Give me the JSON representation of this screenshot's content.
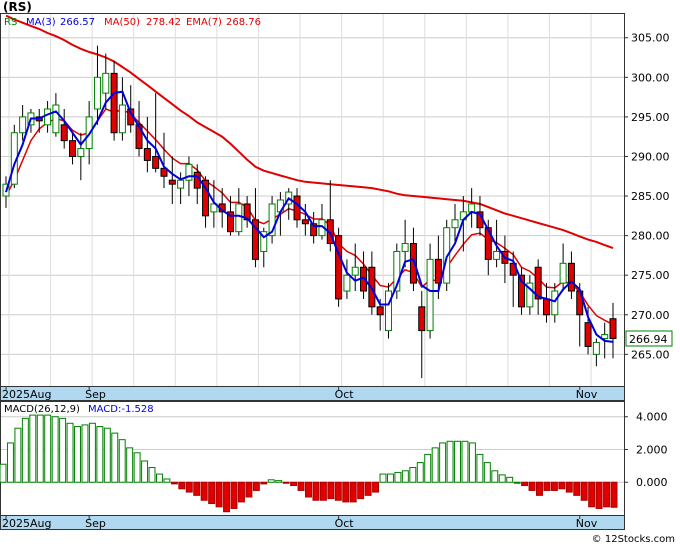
{
  "header": {
    "title": "(RS)",
    "symbol": "RS",
    "ma3_label": "MA(3)",
    "ma3_value": "266.57",
    "ma50_label": "MA(50)",
    "ma50_value": "278.42",
    "ema7_label": "EMA(7)",
    "ema7_value": "268.76",
    "price_tag": "266.94"
  },
  "macd_legend": {
    "label": "MACD(26,12,9)",
    "value_label": "MACD:-1.528"
  },
  "watermark": "© 12Stocks.com",
  "x_labels": [
    "2025Aug",
    "Sep",
    "Oct",
    "Nov"
  ],
  "colors": {
    "up": "#008000",
    "down": "#e00000",
    "ma3": "#0000dd",
    "ma50": "#e00000",
    "ema7": "#e00000",
    "axis_band": "#b0d8f0",
    "grid": "#cccccc"
  },
  "chart_data": [
    {
      "type": "candlestick",
      "ylim": [
        261,
        308
      ],
      "yticks": [
        265,
        270,
        275,
        280,
        285,
        290,
        295,
        300,
        305
      ],
      "ytick_labels": [
        "265.00",
        "270.00",
        "275.00",
        "280.00",
        "285.00",
        "290.00",
        "295.00",
        "300.00",
        "305.00"
      ],
      "last_price": 266.94,
      "ohlc": [
        [
          285,
          287.5,
          283.5,
          286.5
        ],
        [
          286.5,
          294,
          286,
          293
        ],
        [
          293,
          296.5,
          292,
          295
        ],
        [
          294,
          296,
          293,
          295.5
        ],
        [
          295,
          296,
          293,
          294.5
        ],
        [
          294,
          297,
          293,
          296
        ],
        [
          293,
          298,
          292.5,
          296.5
        ],
        [
          294,
          296,
          291,
          292
        ],
        [
          292,
          293,
          289,
          290
        ],
        [
          290,
          293,
          287,
          291
        ],
        [
          291,
          297,
          289,
          295
        ],
        [
          296,
          304,
          294,
          300
        ],
        [
          298,
          303,
          296,
          300.5
        ],
        [
          300.5,
          302,
          292,
          293
        ],
        [
          293,
          300,
          292,
          296.5
        ],
        [
          296,
          299,
          293,
          294
        ],
        [
          294,
          297,
          290,
          291
        ],
        [
          291,
          295,
          288,
          289.5
        ],
        [
          290,
          298,
          288,
          288.5
        ],
        [
          288.5,
          293,
          286,
          287.5
        ],
        [
          287,
          290,
          284,
          286.5
        ],
        [
          286,
          288,
          284,
          287
        ],
        [
          287,
          290,
          285,
          289
        ],
        [
          288,
          289,
          284,
          286
        ],
        [
          287,
          287.5,
          281,
          282.5
        ],
        [
          283,
          287,
          281,
          284
        ],
        [
          284,
          286,
          281,
          283
        ],
        [
          283,
          285,
          280,
          280.5
        ],
        [
          280.5,
          286,
          280,
          284
        ],
        [
          284,
          285,
          281,
          282
        ],
        [
          282,
          286,
          276,
          277
        ],
        [
          278,
          281,
          276,
          280.5
        ],
        [
          280,
          285,
          279,
          284
        ],
        [
          283,
          285.5,
          280,
          284.5
        ],
        [
          284,
          286,
          282,
          285.5
        ],
        [
          285,
          286,
          281,
          282
        ],
        [
          282,
          284,
          280,
          281.5
        ],
        [
          281.5,
          283,
          279,
          280
        ],
        [
          280,
          284,
          279.5,
          282
        ],
        [
          282,
          287,
          278,
          279
        ],
        [
          280,
          281,
          271,
          272
        ],
        [
          273,
          277,
          272,
          275
        ],
        [
          275,
          279,
          273,
          276
        ],
        [
          276,
          278,
          272,
          273
        ],
        [
          276,
          278,
          270,
          271
        ],
        [
          271,
          272,
          268,
          270
        ],
        [
          268,
          274,
          267,
          273
        ],
        [
          273,
          279,
          272,
          278
        ],
        [
          278,
          282,
          276,
          279
        ],
        [
          279,
          281,
          273,
          274
        ],
        [
          271,
          273,
          262,
          268
        ],
        [
          268,
          279,
          267,
          277
        ],
        [
          277,
          280,
          272,
          274
        ],
        [
          274,
          282,
          273,
          281
        ],
        [
          281,
          284,
          279,
          282
        ],
        [
          282,
          285,
          278,
          283
        ],
        [
          283,
          286,
          281,
          284
        ],
        [
          283,
          285,
          280,
          281
        ],
        [
          281,
          282,
          275,
          277
        ],
        [
          277,
          282,
          276,
          278
        ],
        [
          278,
          280,
          274,
          276.5
        ],
        [
          276.5,
          278,
          271,
          275
        ],
        [
          275,
          276,
          270,
          271
        ],
        [
          271,
          275,
          270,
          274
        ],
        [
          276,
          277,
          270,
          272
        ],
        [
          272,
          274,
          269,
          270
        ],
        [
          270,
          274,
          269,
          273
        ],
        [
          274,
          279,
          273,
          276.5
        ],
        [
          276.5,
          278,
          272,
          273
        ],
        [
          273,
          274,
          266,
          270
        ],
        [
          269,
          271,
          265,
          266
        ],
        [
          265,
          267,
          263.5,
          266.5
        ],
        [
          267,
          269,
          264.5,
          267.5
        ],
        [
          269.5,
          271.5,
          264.5,
          267
        ]
      ],
      "ma3": [
        285.5,
        289,
        291.5,
        294.8,
        294.8,
        295.3,
        295.7,
        294.5,
        293,
        291.5,
        292.8,
        294.5,
        296.8,
        298,
        298.2,
        295.5,
        293.8,
        292,
        291,
        288.7,
        287.8,
        287.1,
        287.5,
        287.5,
        286,
        284.2,
        283.2,
        282.5,
        282.5,
        282.2,
        281,
        279.8,
        280.5,
        283,
        284.7,
        284,
        283,
        281.2,
        281.2,
        280.3,
        277.7,
        275.3,
        274.3,
        274.7,
        273.3,
        271.3,
        271.3,
        273.7,
        276.7,
        277,
        273.7,
        273,
        273,
        277.3,
        279,
        282,
        283,
        282.7,
        280.7,
        278.7,
        277.2,
        276.8,
        274.2,
        273.3,
        272.3,
        272,
        271.7,
        273.2,
        274.2,
        273.2,
        269.7,
        267.5,
        266.7,
        266.57
      ],
      "ma50": [
        307.8,
        307.3,
        306.9,
        306.5,
        306.1,
        305.6,
        305.2,
        304.7,
        304.1,
        303.6,
        303.2,
        302.9,
        302.5,
        302,
        301.3,
        300.6,
        299.8,
        299,
        298.2,
        297.4,
        296.6,
        295.8,
        295.1,
        294.3,
        293.7,
        293.1,
        292.5,
        291.6,
        290.6,
        289.6,
        288.7,
        288.2,
        287.9,
        287.6,
        287.3,
        287,
        286.8,
        286.7,
        286.6,
        286.5,
        286.4,
        286.3,
        286.2,
        286.1,
        286,
        285.8,
        285.6,
        285.3,
        285.1,
        285,
        284.9,
        284.8,
        284.7,
        284.6,
        284.5,
        284.4,
        284.2,
        284,
        283.6,
        283.2,
        282.8,
        282.5,
        282.2,
        281.9,
        281.6,
        281.3,
        281,
        280.7,
        280.3,
        279.9,
        279.5,
        279.2,
        278.8,
        278.42
      ],
      "ema7": [
        285,
        287,
        289.5,
        292,
        293.5,
        294.3,
        294.8,
        294.5,
        293.3,
        292.7,
        293,
        294.5,
        296,
        295.6,
        295.9,
        295.4,
        294.3,
        293.2,
        292.1,
        290.9,
        289.8,
        289.1,
        289.1,
        288.3,
        286.9,
        286.2,
        285.4,
        284.2,
        284.2,
        283.6,
        281.9,
        281.5,
        282.1,
        282.7,
        283.4,
        283.1,
        282.7,
        282.1,
        282.1,
        281.3,
        279,
        278,
        277.5,
        276.4,
        275,
        273.7,
        273.5,
        274.6,
        275.7,
        275.3,
        273.5,
        274.4,
        274.3,
        276,
        277.5,
        278.9,
        280.1,
        280.3,
        279.5,
        279.1,
        278.4,
        277.6,
        276,
        275.5,
        274.6,
        273.5,
        273.4,
        274.2,
        273.9,
        272.9,
        271.2,
        269.9,
        269.3,
        268.76
      ]
    },
    {
      "type": "bar",
      "title": "MACD(26,12,9)",
      "current_value": -1.528,
      "ylim": [
        -2.0,
        4.9
      ],
      "yticks": [
        0,
        2,
        4
      ],
      "ytick_labels": [
        "0.000",
        "2.000",
        "4.000"
      ],
      "values": [
        1.1,
        2.4,
        3.3,
        3.9,
        4.1,
        4.1,
        4.1,
        4.0,
        3.9,
        3.6,
        3.4,
        3.5,
        3.6,
        3.4,
        3.3,
        3.0,
        2.6,
        2.1,
        1.8,
        1.3,
        0.9,
        0.5,
        0.2,
        -0.1,
        -0.4,
        -0.6,
        -0.8,
        -1.1,
        -1.3,
        -1.5,
        -1.8,
        -1.6,
        -1.2,
        -0.9,
        -0.5,
        -0.1,
        0.15,
        0.1,
        -0.05,
        -0.2,
        -0.5,
        -0.9,
        -1.1,
        -1.1,
        -1.0,
        -1.1,
        -1.2,
        -1.2,
        -1.0,
        -0.8,
        -0.6,
        0.5,
        0.5,
        0.6,
        0.7,
        0.9,
        1.2,
        1.7,
        2.1,
        2.4,
        2.5,
        2.5,
        2.5,
        2.4,
        1.7,
        1.2,
        0.7,
        0.45,
        0.3,
        0.0,
        -0.2,
        -0.5,
        -0.8,
        -0.5,
        -0.5,
        -0.4,
        -0.6,
        -0.8,
        -1.1,
        -1.5,
        -1.6,
        -1.5,
        -1.528
      ]
    }
  ]
}
